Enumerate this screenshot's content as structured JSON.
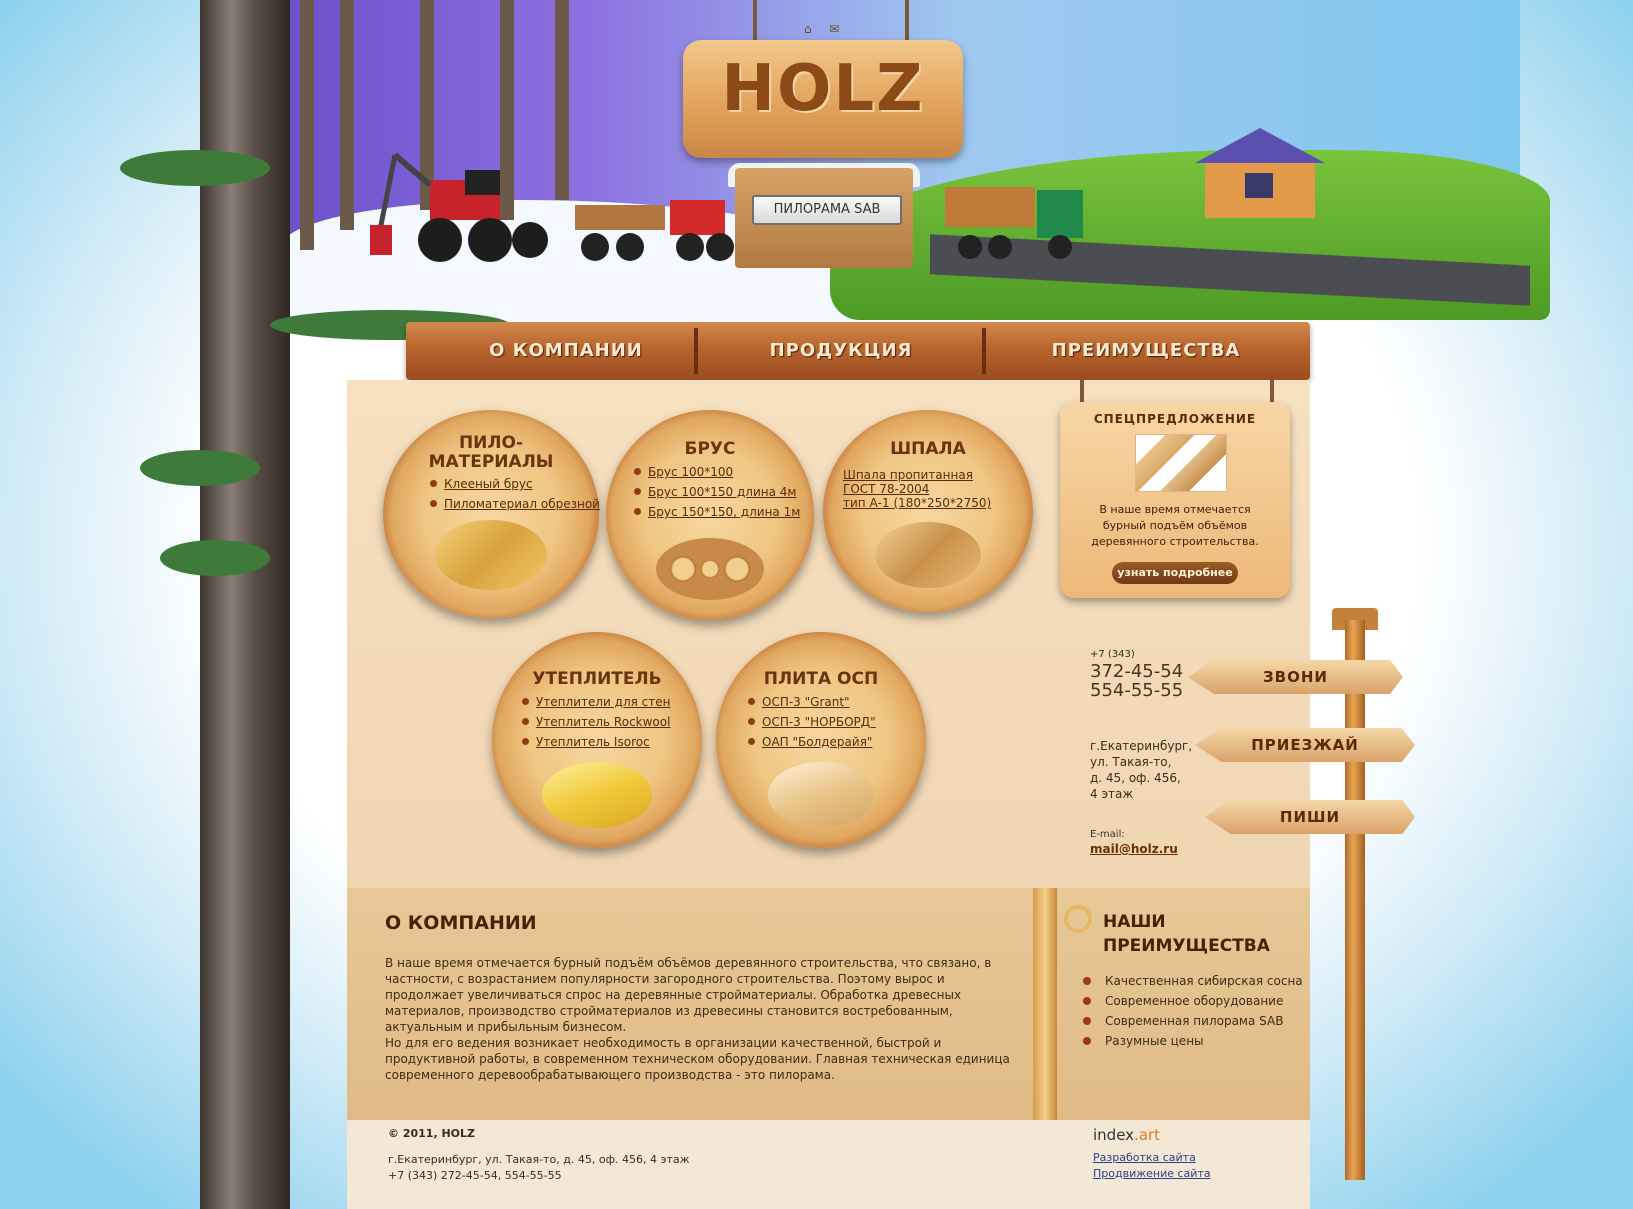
{
  "header": {
    "logo": "HOLZ",
    "icons": [
      "home-icon",
      "mail-icon"
    ],
    "sawmill_label": "ПИЛОРАМА SAB"
  },
  "nav": [
    {
      "label": "О КОМПАНИИ"
    },
    {
      "label": "ПРОДУКЦИЯ"
    },
    {
      "label": "ПРЕИМУЩЕСТВА"
    }
  ],
  "products": [
    {
      "title": "ПИЛО-\nМАТЕРИАЛЫ",
      "links": [
        "Клееный брус",
        "Пиломатериал обрезной"
      ]
    },
    {
      "title": "БРУС",
      "links": [
        "Брус 100*100",
        "Брус 100*150 длина 4м",
        "Брус 150*150, длина 1м"
      ]
    },
    {
      "title": "ШПАЛА",
      "links": [
        "Шпала пропитанная\nГОСТ 78-2004\nтип А-1 (180*250*2750)"
      ]
    },
    {
      "title": "УТЕПЛИТЕЛЬ",
      "links": [
        "Утеплители для стен",
        "Утеплитель Rockwool",
        "Утеплитель Isoroc"
      ]
    },
    {
      "title": "ПЛИТА ОСП",
      "links": [
        "ОСП-3 \"Grant\"",
        "ОСП-3 \"НОРБОРД\"",
        "ОАП \"Болдерайя\""
      ]
    }
  ],
  "offer": {
    "title": "СПЕЦПРЕДЛОЖЕНИЕ",
    "text": "В наше время отмечается бурный подъём объёмов деревянного строительства.",
    "button": "узнать подробнее"
  },
  "contacts": {
    "code": "+7 (343)",
    "phone1": "372-45-54",
    "phone2": "554-55-55",
    "address": "г.Екатеринбург,\nул. Такая-то,\nд. 45, оф. 456,\n4 этаж",
    "email_label": "E-mail:",
    "email": "mail@holz.ru"
  },
  "signs": [
    "ЗВОНИ",
    "ПРИЕЗЖАЙ",
    "ПИШИ"
  ],
  "about": {
    "title": "О КОМПАНИИ",
    "paragraphs": [
      "В наше время отмечается бурный подъём объёмов деревянного строительства, что связано, в частности, с возрастанием популярности загородного строительства. Поэтому вырос и продолжает увеличиваться спрос на деревянные стройматериалы. Обработка древесных материалов, производство стройматериалов из древесины становится востребованным, актуальным и прибыльным бизнесом.",
      "Но для его ведения возникает необходимость в организации качественной, быстрой и продуктивной работы, в современном техническом оборудовании. Главная техническая единица современного деревообрабатывающего производства - это пилорама."
    ]
  },
  "advantages": {
    "title": "НАШИ\nПРЕИМУЩЕСТВА",
    "items": [
      "Качественная сибирская сосна",
      "Современное оборудование",
      "Современная пилорама SAB",
      "Разумные цены"
    ]
  },
  "footer": {
    "copyright": "© 2011, HOLZ",
    "address": "г.Екатеринбург, ул. Такая-то, д. 45, оф. 456, 4 этаж",
    "phones": "+7 (343) 272-45-54, 554-55-55",
    "brand_a": "index",
    "brand_b": ".art",
    "dev_link": "Разработка сайта",
    "promo_link": "Продвижение сайта"
  },
  "colors": {
    "wood_dark": "#6b3410",
    "nav": "#b8642e",
    "panel": "#f5e0c0",
    "link": "#5a2b06"
  }
}
